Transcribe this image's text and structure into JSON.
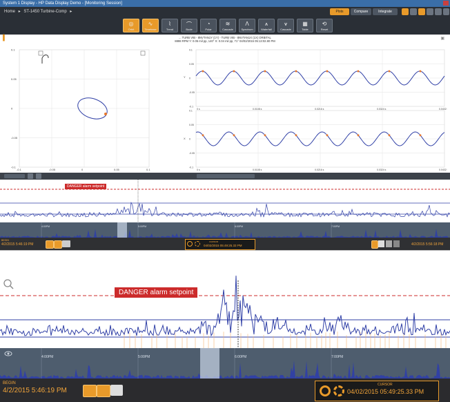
{
  "window": {
    "title": "System 1 Display - HP Data Display Demo - [Monitoring Session]"
  },
  "nav": {
    "home": "Home",
    "sep1": "▸",
    "asset": "ST-1450 Turbine-Comp",
    "sep2": "▸",
    "btn_plot": "Plots",
    "btn_compare": "Compare",
    "btn_integrate": "Integrate"
  },
  "toolbar": {
    "tools": [
      {
        "label": "Orbit",
        "icon": "orbit-icon"
      },
      {
        "label": "Timebase",
        "icon": "timebase-icon"
      },
      {
        "label": "Trend",
        "icon": "trend-icon"
      },
      {
        "label": "Bode",
        "icon": "bode-icon"
      },
      {
        "label": "Polar",
        "icon": "polar-icon"
      },
      {
        "label": "Cascade",
        "icon": "cascade-icon"
      },
      {
        "label": "Spectrum",
        "icon": "spectrum-icon"
      },
      {
        "label": "Waterfall",
        "icon": "waterfall-icon"
      },
      {
        "label": "Cascade",
        "icon": "cascade2-icon"
      },
      {
        "label": "Table",
        "icon": "table-icon"
      },
      {
        "label": "Reset",
        "icon": "reset-icon"
      }
    ]
  },
  "info": {
    "line1": "... TURB VIB - 8NVTAN1Y (1Y) - TURB VIB - 8NVTAN1X (1X) ORBITAL",
    "line2": "8898 RPM   Y: 0.05 mil pp, 140°   X: 0.04 mil pp, 71°   04/02/2015 05:13:02.80 PM"
  },
  "orbit": {
    "y_ticks": [
      "0.1",
      "0.05",
      "0",
      "-0.05",
      "-0.1"
    ],
    "x_ticks": [
      "-0.1",
      "-0.05",
      "0",
      "0.05",
      "0.1"
    ]
  },
  "timebase": {
    "top_y_ticks": [
      "0.1",
      "0.05",
      "0",
      "-0.05",
      "-0.1"
    ],
    "bottom_y_ticks": [
      "0.1",
      "0.05",
      "0",
      "-0.05",
      "-0.1"
    ],
    "x_ticks": [
      "0 s",
      "0.0108 s",
      "0.0216 s",
      "0.0324 s",
      "0.0432 s"
    ],
    "top_axis_label": "Y",
    "bottom_axis_label": "X"
  },
  "trend": {
    "alarm_label": "DANGER alarm setpoint",
    "overview_times": [
      "4:00PM",
      "5:00PM",
      "6:00PM",
      "7:00PM"
    ]
  },
  "status_top": {
    "begin_label": "BEGIN",
    "begin_time": "4/2/2015 5:46:19 PM",
    "cursor_label": "CURSOR",
    "cursor_time": "04/02/2015 05:49:25.33 PM",
    "end_time": "4/2/2015 5:56:18 PM"
  },
  "status_bottom": {
    "begin_label": "BEGIN",
    "begin_time": "4/2/2015 5:46:19 PM",
    "cursor_label": "CURSOR",
    "cursor_time": "04/02/2015 05:49:25.33 PM"
  },
  "colors": {
    "accent": "#e89a2a",
    "waveform": "#2f3fa6",
    "alarm": "#cc2b2b"
  }
}
